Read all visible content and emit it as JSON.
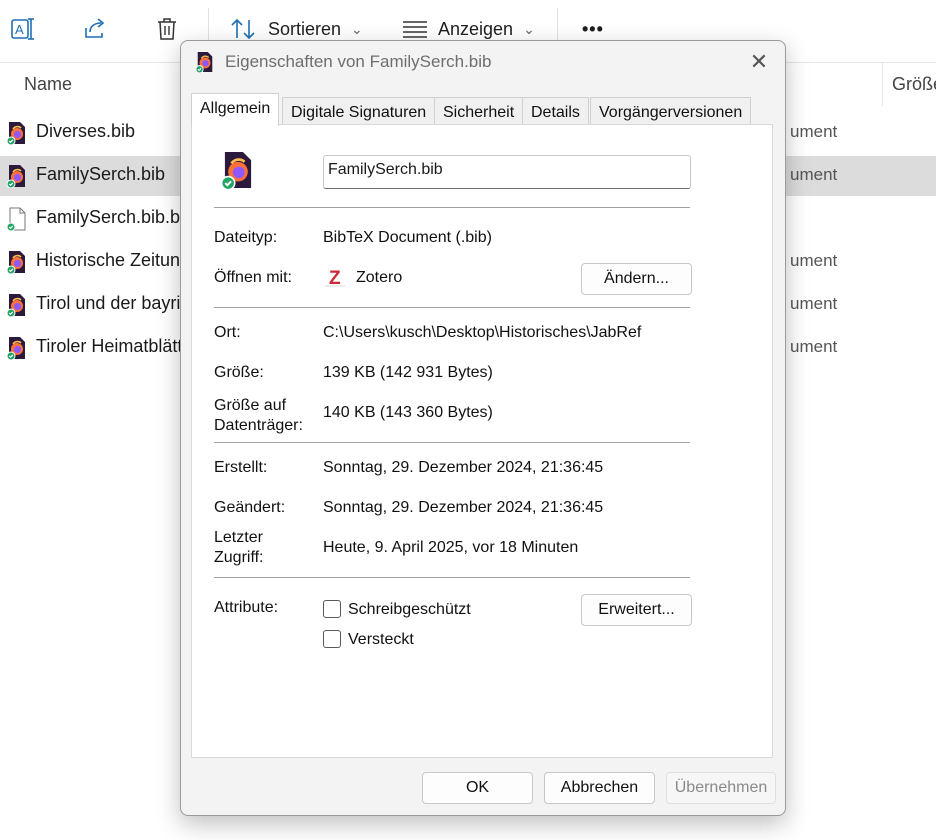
{
  "toolbar": {
    "sort_label": "Sortieren",
    "view_label": "Anzeigen",
    "more_label": "•••",
    "sort_chevron": "⌄",
    "view_chevron": "⌄"
  },
  "columns": {
    "name": "Name",
    "size": "Größe"
  },
  "files": [
    {
      "name": "Diverses.bib",
      "type": "ument",
      "icon": "firefox-bib-icon"
    },
    {
      "name": "FamilySerch.bib",
      "type": "ument",
      "icon": "firefox-bib-icon"
    },
    {
      "name": "FamilySerch.bib.ba",
      "type": "",
      "icon": "blank-file-icon"
    },
    {
      "name": "Historische Zeitung",
      "type": "ument",
      "icon": "firefox-bib-icon"
    },
    {
      "name": "Tirol und der bayri",
      "type": "ument",
      "icon": "firefox-bib-icon"
    },
    {
      "name": "Tiroler Heimatblätt",
      "type": "ument",
      "icon": "firefox-bib-icon"
    }
  ],
  "dialog": {
    "title": "Eigenschaften von FamilySerch.bib",
    "close": "✕",
    "tabs": [
      "Allgemein",
      "Digitale Signaturen",
      "Sicherheit",
      "Details",
      "Vorgängerversionen"
    ],
    "file_name": "FamilySerch.bib",
    "labels": {
      "type": "Dateityp:",
      "open_with": "Öffnen mit:",
      "location": "Ort:",
      "size": "Größe:",
      "size_on_disk_1": "Größe auf",
      "size_on_disk_2": "Datenträger:",
      "created": "Erstellt:",
      "modified": "Geändert:",
      "accessed_1": "Letzter",
      "accessed_2": "Zugriff:",
      "attributes": "Attribute:"
    },
    "values": {
      "type": "BibTeX Document (.bib)",
      "open_with": "Zotero",
      "location": "C:\\Users\\kusch\\Desktop\\Historisches\\JabRef",
      "size": "139 KB (142 931 Bytes)",
      "size_on_disk": "140 KB (143 360 Bytes)",
      "created": "Sonntag, 29. Dezember 2024, 21:36:45",
      "modified": "Sonntag, 29. Dezember 2024, 21:36:45",
      "accessed": "Heute, 9. April 2025, vor 18 Minuten"
    },
    "buttons": {
      "change": "Ändern...",
      "advanced": "Erweitert...",
      "ok": "OK",
      "cancel": "Abbrechen",
      "apply": "Übernehmen"
    },
    "checkboxes": {
      "readonly": "Schreibgeschützt",
      "hidden": "Versteckt"
    },
    "zotero_letter": "Z",
    "colors": {
      "accent": "#0067c0",
      "zotero": "#cc2936"
    }
  }
}
